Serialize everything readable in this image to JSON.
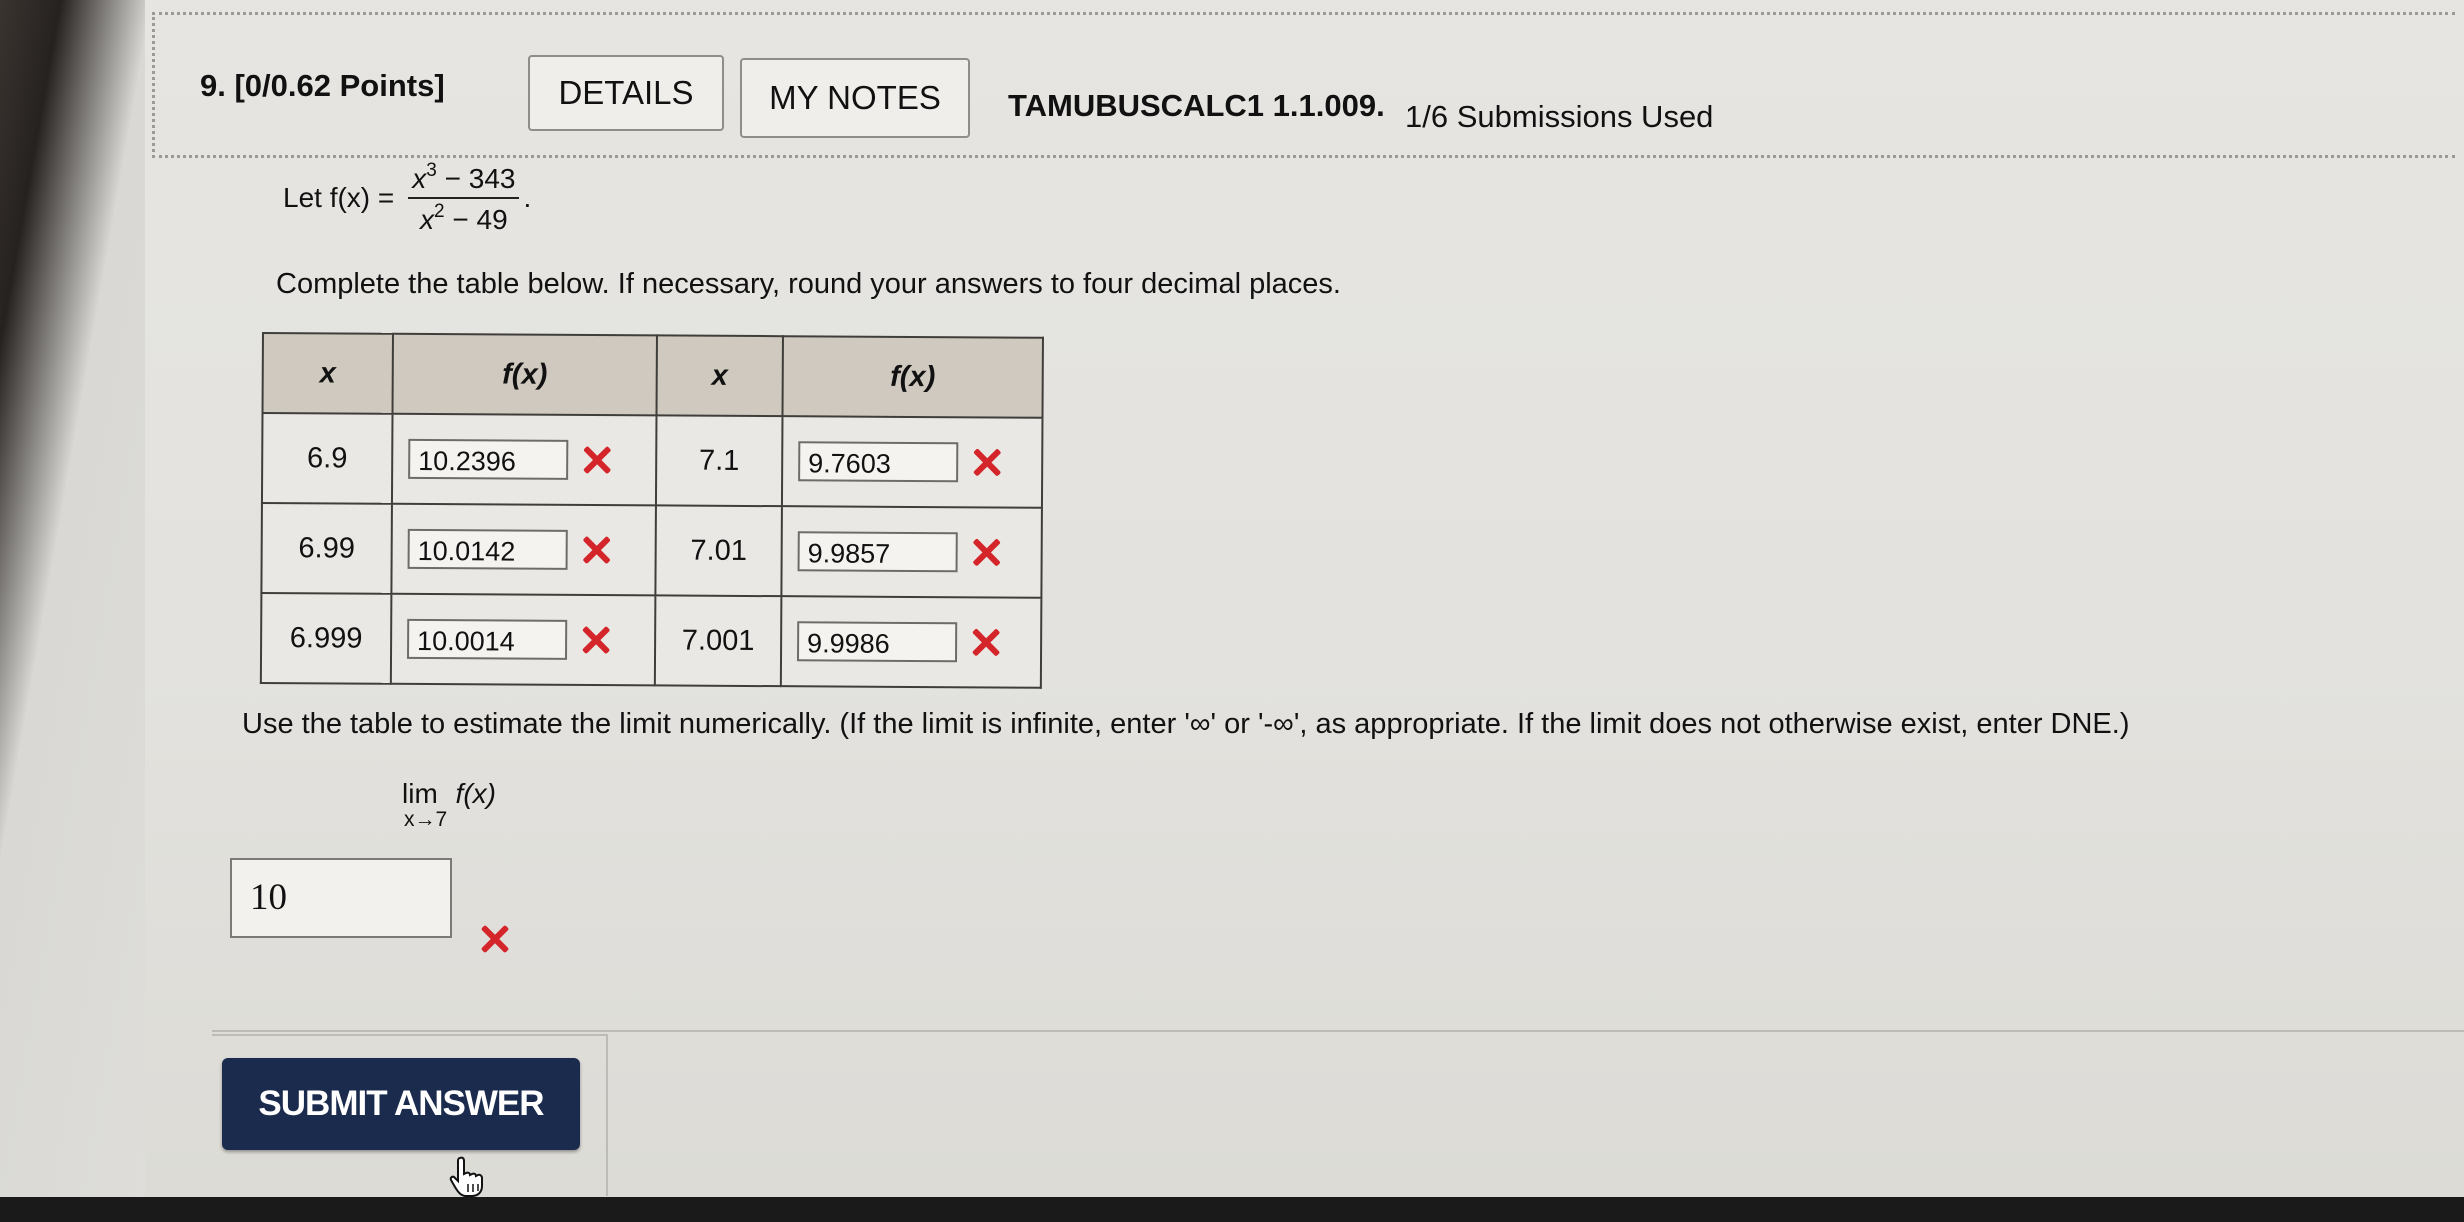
{
  "question": {
    "number_points": "9. [0/0.62 Points]",
    "details_label": "DETAILS",
    "my_notes_label": "MY NOTES",
    "course_id": "TAMUBUSCALC1 1.1.009.",
    "submissions": "1/6 Submissions Used"
  },
  "problem": {
    "let_prefix": "Let f(x) =",
    "numerator_base": "x",
    "numerator_exp": "3",
    "numerator_rest": " − 343",
    "denominator_base": "x",
    "denominator_exp": "2",
    "denominator_rest": " − 49",
    "period": ".",
    "instructions": "Complete the table below. If necessary, round your answers to four decimal places."
  },
  "table": {
    "headers": [
      "x",
      "f(x)",
      "x",
      "f(x)"
    ],
    "rows": [
      {
        "x_left": "6.9",
        "f_left": "10.2396",
        "x_right": "7.1",
        "f_right": "9.7603"
      },
      {
        "x_left": "6.99",
        "f_left": "10.0142",
        "x_right": "7.01",
        "f_right": "9.9857"
      },
      {
        "x_left": "6.999",
        "f_left": "10.0014",
        "x_right": "7.001",
        "f_right": "9.9986"
      }
    ],
    "status_icon": "incorrect-x-icon",
    "status_color": "#d4252a"
  },
  "limit": {
    "instructions": "Use the table to estimate the limit numerically. (If the limit is infinite, enter '∞' or '-∞', as appropriate. If the limit does not otherwise exist, enter DNE.)",
    "lim_label": "lim",
    "lim_expr": "f(x)",
    "lim_sub": "x→7",
    "answer": "10"
  },
  "submit": {
    "label": "SUBMIT ANSWER",
    "color": "#1b2b4d"
  }
}
